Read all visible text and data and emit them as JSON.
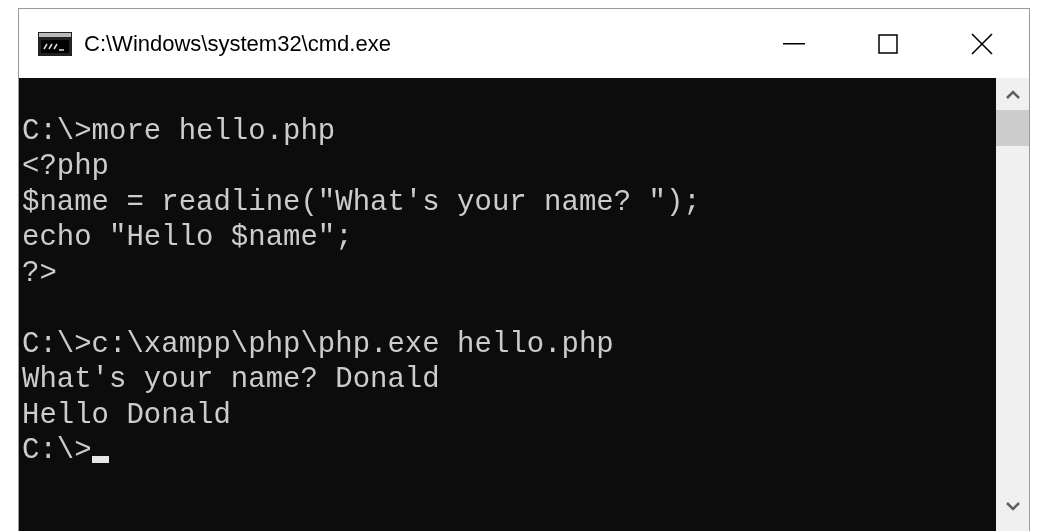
{
  "window": {
    "title": "C:\\Windows\\system32\\cmd.exe"
  },
  "console": {
    "lines": [
      {
        "kind": "blank"
      },
      {
        "kind": "text",
        "text": "C:\\>more hello.php"
      },
      {
        "kind": "text",
        "text": "<?php"
      },
      {
        "kind": "text",
        "text": "$name = readline(\"What's your name? \");"
      },
      {
        "kind": "text",
        "text": "echo \"Hello $name\";"
      },
      {
        "kind": "text",
        "text": "?>"
      },
      {
        "kind": "blank"
      },
      {
        "kind": "text",
        "text": "C:\\>c:\\xampp\\php\\php.exe hello.php"
      },
      {
        "kind": "text",
        "text": "What's your name? Donald"
      },
      {
        "kind": "text",
        "text": "Hello Donald"
      },
      {
        "kind": "text",
        "text": "C:\\>",
        "cursor": true
      }
    ]
  }
}
